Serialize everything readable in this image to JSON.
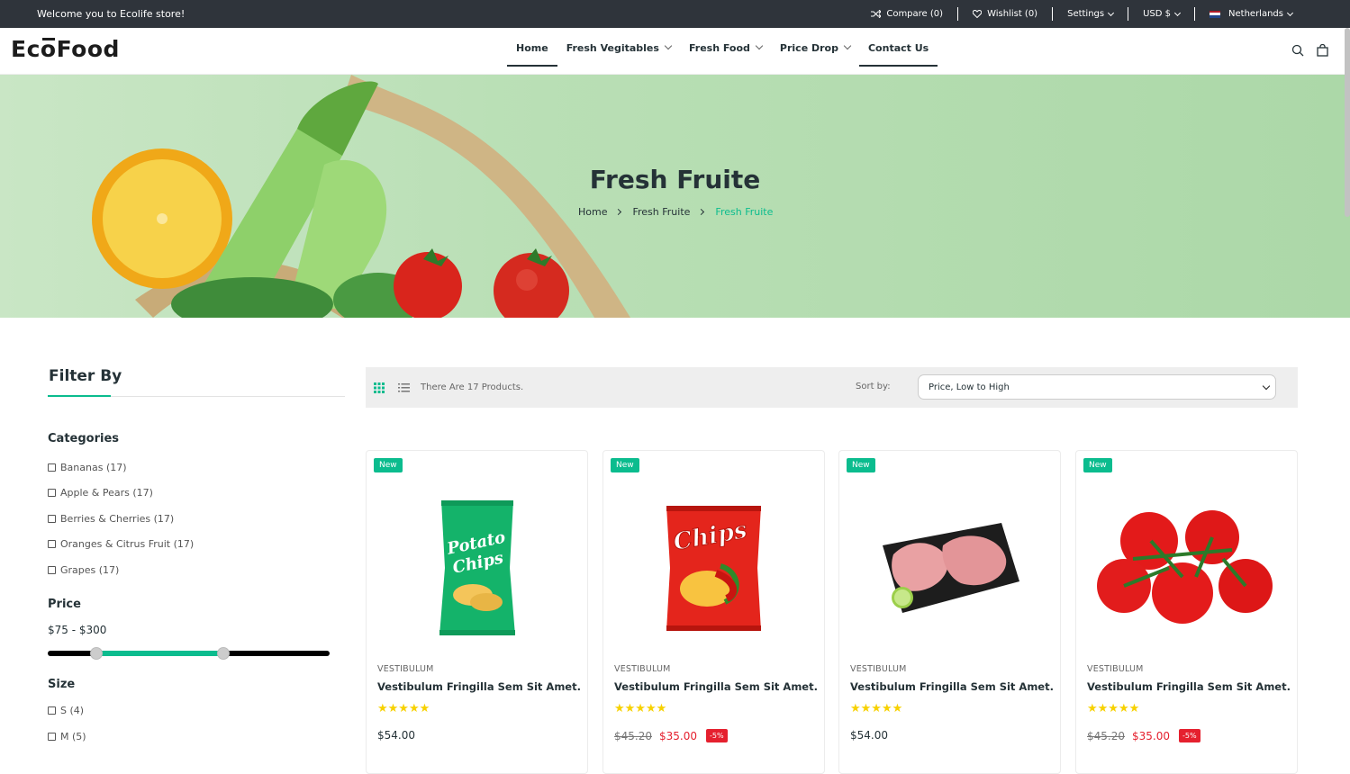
{
  "topbar": {
    "welcome": "Welcome you to Ecolife store!",
    "compare": "Compare (0)",
    "wishlist": "Wishlist (0)",
    "settings": "Settings",
    "currency": "USD $",
    "language": "Netherlands"
  },
  "header": {
    "logo": "EcoFood",
    "nav": [
      {
        "label": "Home"
      },
      {
        "label": "Fresh Vegitables"
      },
      {
        "label": "Fresh Food"
      },
      {
        "label": "Price Drop"
      },
      {
        "label": "Contact Us"
      }
    ]
  },
  "banner": {
    "title": "Fresh Fruite",
    "breadcrumb": [
      "Home",
      "Fresh Fruite",
      "Fresh Fruite"
    ]
  },
  "sidebar": {
    "title": "Filter By",
    "categories_heading": "Categories",
    "categories": [
      "Bananas (17)",
      "Apple & Pears (17)",
      "Berries & Cherries (17)",
      "Oranges & Citrus Fruit (17)",
      "Grapes (17)"
    ],
    "price_heading": "Price",
    "price_range": "$75 - $300",
    "size_heading": "Size",
    "sizes": [
      "S (4)",
      "M (5)"
    ]
  },
  "toolbar": {
    "count": "There Are 17 Products.",
    "sort_label": "Sort by:",
    "sort_value": "Price, Low to High"
  },
  "products": [
    {
      "badge": "New",
      "vendor": "VESTIBULUM",
      "name": "Vestibulum Fringilla Sem Sit Amet.",
      "stars": "★★★★★",
      "old_price": "",
      "price": "$54.00",
      "discount": ""
    },
    {
      "badge": "New",
      "vendor": "VESTIBULUM",
      "name": "Vestibulum Fringilla Sem Sit Amet.",
      "stars": "★★★★★",
      "old_price": "$45.20",
      "price": "$35.00",
      "discount": "-5%"
    },
    {
      "badge": "New",
      "vendor": "VESTIBULUM",
      "name": "Vestibulum Fringilla Sem Sit Amet.",
      "stars": "★★★★★",
      "old_price": "",
      "price": "$54.00",
      "discount": ""
    },
    {
      "badge": "New",
      "vendor": "VESTIBULUM",
      "name": "Vestibulum Fringilla Sem Sit Amet.",
      "stars": "★★★★★",
      "old_price": "$45.20",
      "price": "$35.00",
      "discount": "-5%"
    }
  ],
  "colors": {
    "accent": "#0bbc8e",
    "sale": "#e5202e",
    "topbar": "#2f343b"
  }
}
